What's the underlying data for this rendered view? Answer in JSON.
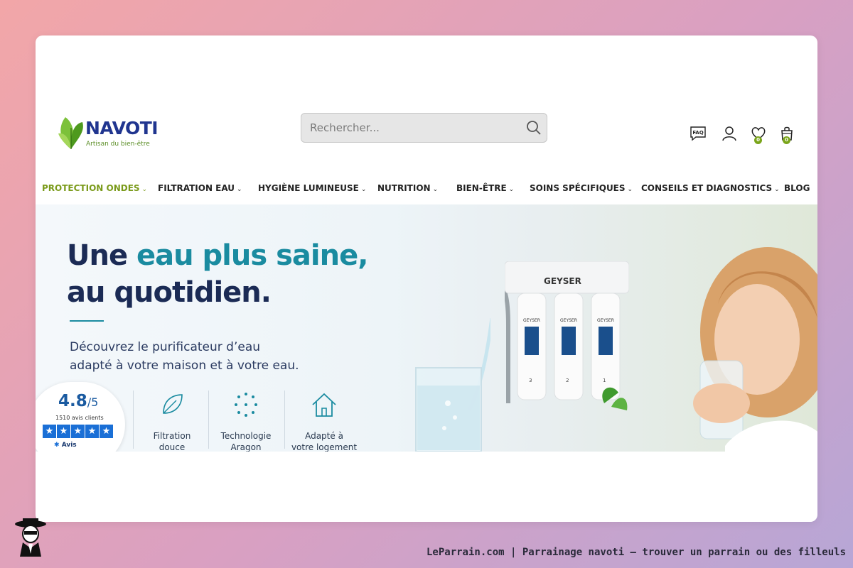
{
  "header": {
    "logo": {
      "name": "NAVOTI",
      "tagline": "Artisan du bien-être"
    },
    "search": {
      "placeholder": "Rechercher..."
    },
    "icons": [
      {
        "name": "faq-icon",
        "label": "FAQ"
      },
      {
        "name": "account-icon"
      },
      {
        "name": "wishlist-icon",
        "count": "0"
      },
      {
        "name": "cart-icon",
        "count": "0"
      }
    ]
  },
  "nav": {
    "items": [
      {
        "label": "PROTECTION ONDES",
        "dropdown": true,
        "active": true
      },
      {
        "label": "FILTRATION EAU",
        "dropdown": true
      },
      {
        "label": "HYGIÈNE LUMINEUSE",
        "dropdown": true
      },
      {
        "label": "NUTRITION",
        "dropdown": true
      },
      {
        "label": "BIEN-ÊTRE",
        "dropdown": true
      },
      {
        "label": "SOINS SPÉCIFIQUES",
        "dropdown": true
      },
      {
        "label": "CONSEILS ET DIAGNOSTICS",
        "dropdown": true
      },
      {
        "label": "BLOG",
        "dropdown": false
      }
    ]
  },
  "hero": {
    "title_part1": "Une ",
    "title_accent": "eau plus saine,",
    "title_line2": "au quotidien.",
    "subtitle_line1": "Découvrez le purificateur d’eau",
    "subtitle_line2": "adapté à votre maison et à votre eau.",
    "rating": {
      "score": "4.8",
      "out_of": "/5",
      "count": "1510 avis clients",
      "source": "Avis"
    },
    "features": [
      {
        "icon": "leaf-icon",
        "line1": "Filtration",
        "line2": "douce"
      },
      {
        "icon": "dots-icon",
        "line1": "Technologie",
        "line2": "Aragon"
      },
      {
        "icon": "house-icon",
        "line1": "Adapté à",
        "line2": "votre logement"
      }
    ],
    "device_brand": "GEYSER",
    "cartridge_labels": [
      "GEYSER",
      "GEYSER",
      "GEYSER"
    ],
    "cartridge_numbers": [
      "3",
      "2",
      "1"
    ]
  },
  "footer_watermark": "LeParrain.com | Parrainage navoti — trouver un parrain ou des filleuls",
  "colors": {
    "accent": "#1a8ba0",
    "navy": "#1b2b55",
    "nav_active": "#7a9a1a",
    "star_blue": "#1a6fd6"
  }
}
